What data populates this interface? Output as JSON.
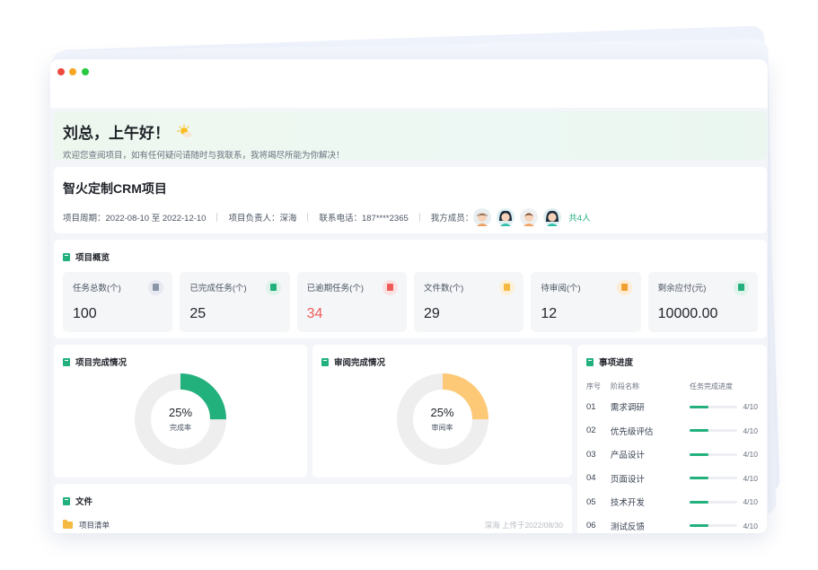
{
  "greeting": {
    "title": "刘总，上午好！",
    "subtitle": "欢迎您查阅项目，如有任何疑问请随时与我联系，我将竭尽所能为你解决！"
  },
  "project": {
    "name": "智火定制CRM项目",
    "period": "项目周期：2022-08-10 至 2022-12-10",
    "owner": "项目负责人：深海",
    "phone": "联系电话：187****2365",
    "members_label": "我方成员：",
    "members_total": "共4人"
  },
  "overview": {
    "title": "项目概览",
    "cards": [
      {
        "label": "任务总数(个)",
        "value": "100",
        "color": "#8b95a8",
        "bg": "#e6e9f0"
      },
      {
        "label": "已完成任务(个)",
        "value": "25",
        "color": "#22b07d",
        "bg": "#dff3ea"
      },
      {
        "label": "已逾期任务(个)",
        "value": "34",
        "color": "#ef5b5b",
        "bg": "#fbe2e2"
      },
      {
        "label": "文件数(个)",
        "value": "29",
        "color": "#f5b942",
        "bg": "#fdf0d8"
      },
      {
        "label": "待审阅(个)",
        "value": "12",
        "color": "#f0a030",
        "bg": "#fdecd3"
      },
      {
        "label": "剩余应付(元)",
        "value": "10000.00",
        "color": "#22b07d",
        "bg": "#dff3ea"
      }
    ]
  },
  "completion": {
    "title": "项目完成情况",
    "percent_text": "25%",
    "label": "完成率",
    "value": 0.25,
    "color": "#22b07d"
  },
  "review": {
    "title": "审阅完成情况",
    "percent_text": "25%",
    "label": "审阅率",
    "value": 0.25,
    "color": "#fdc977"
  },
  "files": {
    "title": "文件",
    "items": [
      {
        "name": "项目清单",
        "upload": "深海 上传于2022/08/30"
      }
    ]
  },
  "progress": {
    "title": "事项进度",
    "col_no": "序号",
    "col_name": "阶段名称",
    "col_progress": "任务完成进度",
    "rows": [
      {
        "no": "01",
        "name": "需求调研",
        "value": 0.4,
        "text": "4/10"
      },
      {
        "no": "02",
        "name": "优先级评估",
        "value": 0.4,
        "text": "4/10"
      },
      {
        "no": "03",
        "name": "产品设计",
        "value": 0.4,
        "text": "4/10"
      },
      {
        "no": "04",
        "name": "页面设计",
        "value": 0.4,
        "text": "4/10"
      },
      {
        "no": "05",
        "name": "技术开发",
        "value": 0.4,
        "text": "4/10"
      },
      {
        "no": "06",
        "name": "测试反馈",
        "value": 0.4,
        "text": "4/10"
      }
    ]
  }
}
